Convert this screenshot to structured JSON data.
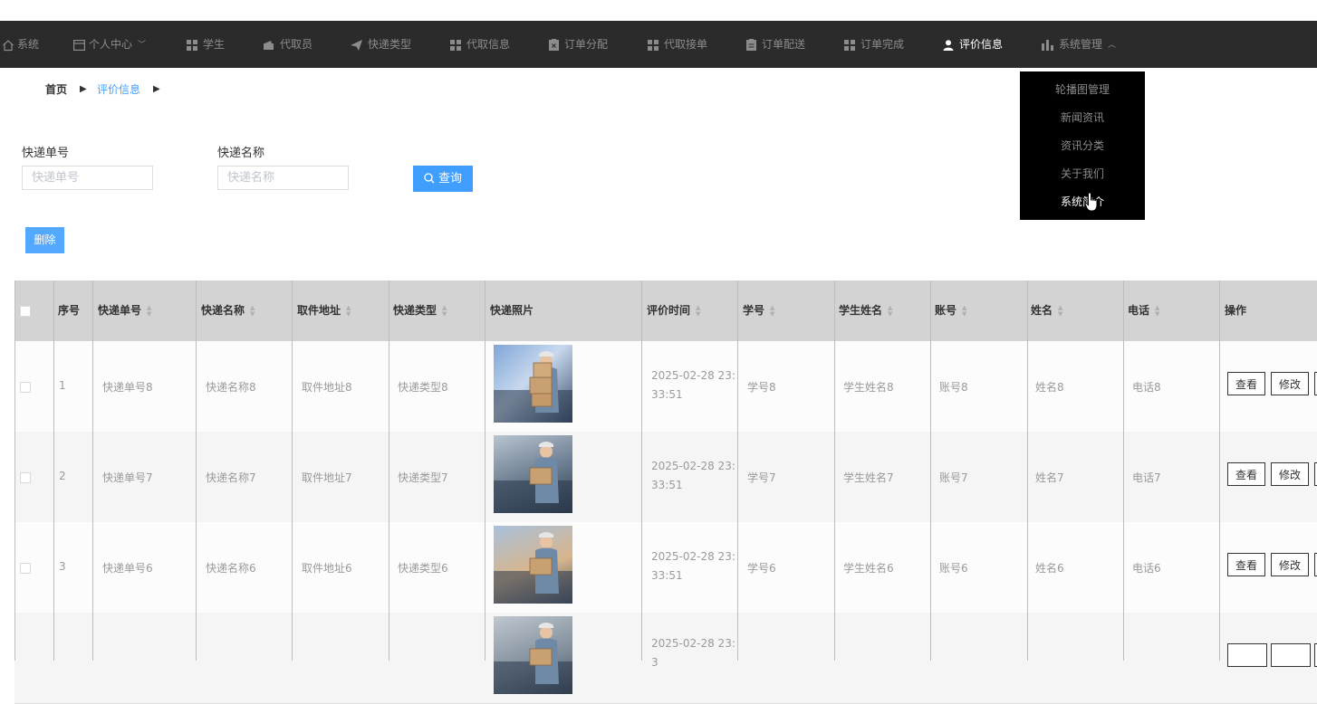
{
  "nav": {
    "items": [
      {
        "label": "系统",
        "icon": "home-icon"
      },
      {
        "label": "个人中心",
        "icon": "profile-card-icon",
        "dropdown": true
      },
      {
        "label": "学生",
        "icon": "grid-icon"
      },
      {
        "label": "代取员",
        "icon": "wallet-icon"
      },
      {
        "label": "快递类型",
        "icon": "paper-plane-icon"
      },
      {
        "label": "代取信息",
        "icon": "grid-icon"
      },
      {
        "label": "订单分配",
        "icon": "clipboard-x-icon"
      },
      {
        "label": "代取接单",
        "icon": "grid-icon"
      },
      {
        "label": "订单配送",
        "icon": "clipboard-icon"
      },
      {
        "label": "订单完成",
        "icon": "grid-icon"
      },
      {
        "label": "评价信息",
        "icon": "user-icon",
        "active": true
      },
      {
        "label": "系统管理",
        "icon": "bar-chart-icon",
        "dropdown": true
      }
    ],
    "dropdown_items": [
      "轮播图管理",
      "新闻资讯",
      "资讯分类",
      "关于我们",
      "系统简介"
    ]
  },
  "breadcrumb": {
    "home": "首页",
    "current": "评价信息"
  },
  "search": {
    "fields": [
      {
        "label": "快递单号",
        "placeholder": "快递单号"
      },
      {
        "label": "快递名称",
        "placeholder": "快递名称"
      }
    ],
    "query_label": "查询"
  },
  "actions": {
    "delete_label": "删除"
  },
  "table": {
    "headers": [
      "序号",
      "快递单号",
      "快递名称",
      "取件地址",
      "快递类型",
      "快递照片",
      "评价时间",
      "学号",
      "学生姓名",
      "账号",
      "姓名",
      "电话",
      "操作"
    ],
    "rows": [
      {
        "no": "1",
        "tracking": "快递单号8",
        "name": "快递名称8",
        "address": "取件地址8",
        "type": "快递类型8",
        "time": "2025-02-28 23:33:51",
        "student_id": "学号8",
        "student_name": "学生姓名8",
        "account": "账号8",
        "person": "姓名8",
        "phone": "电话8"
      },
      {
        "no": "2",
        "tracking": "快递单号7",
        "name": "快递名称7",
        "address": "取件地址7",
        "type": "快递类型7",
        "time": "2025-02-28 23:33:51",
        "student_id": "学号7",
        "student_name": "学生姓名7",
        "account": "账号7",
        "person": "姓名7",
        "phone": "电话7"
      },
      {
        "no": "3",
        "tracking": "快递单号6",
        "name": "快递名称6",
        "address": "取件地址6",
        "type": "快递类型6",
        "time": "2025-02-28 23:33:51",
        "student_id": "学号6",
        "student_name": "学生姓名6",
        "account": "账号6",
        "person": "姓名6",
        "phone": "电话6"
      },
      {
        "no": "",
        "tracking": "",
        "name": "",
        "address": "",
        "type": "",
        "time": "2025-02-28 23:3",
        "student_id": "",
        "student_name": "",
        "account": "",
        "person": "",
        "phone": ""
      }
    ],
    "row_actions": [
      "查看",
      "修改"
    ]
  },
  "colors": {
    "nav_bg": "#2b2b2b",
    "primary": "#409eff",
    "dropdown_bg": "#000000",
    "header_bg": "#d3d3d3"
  }
}
